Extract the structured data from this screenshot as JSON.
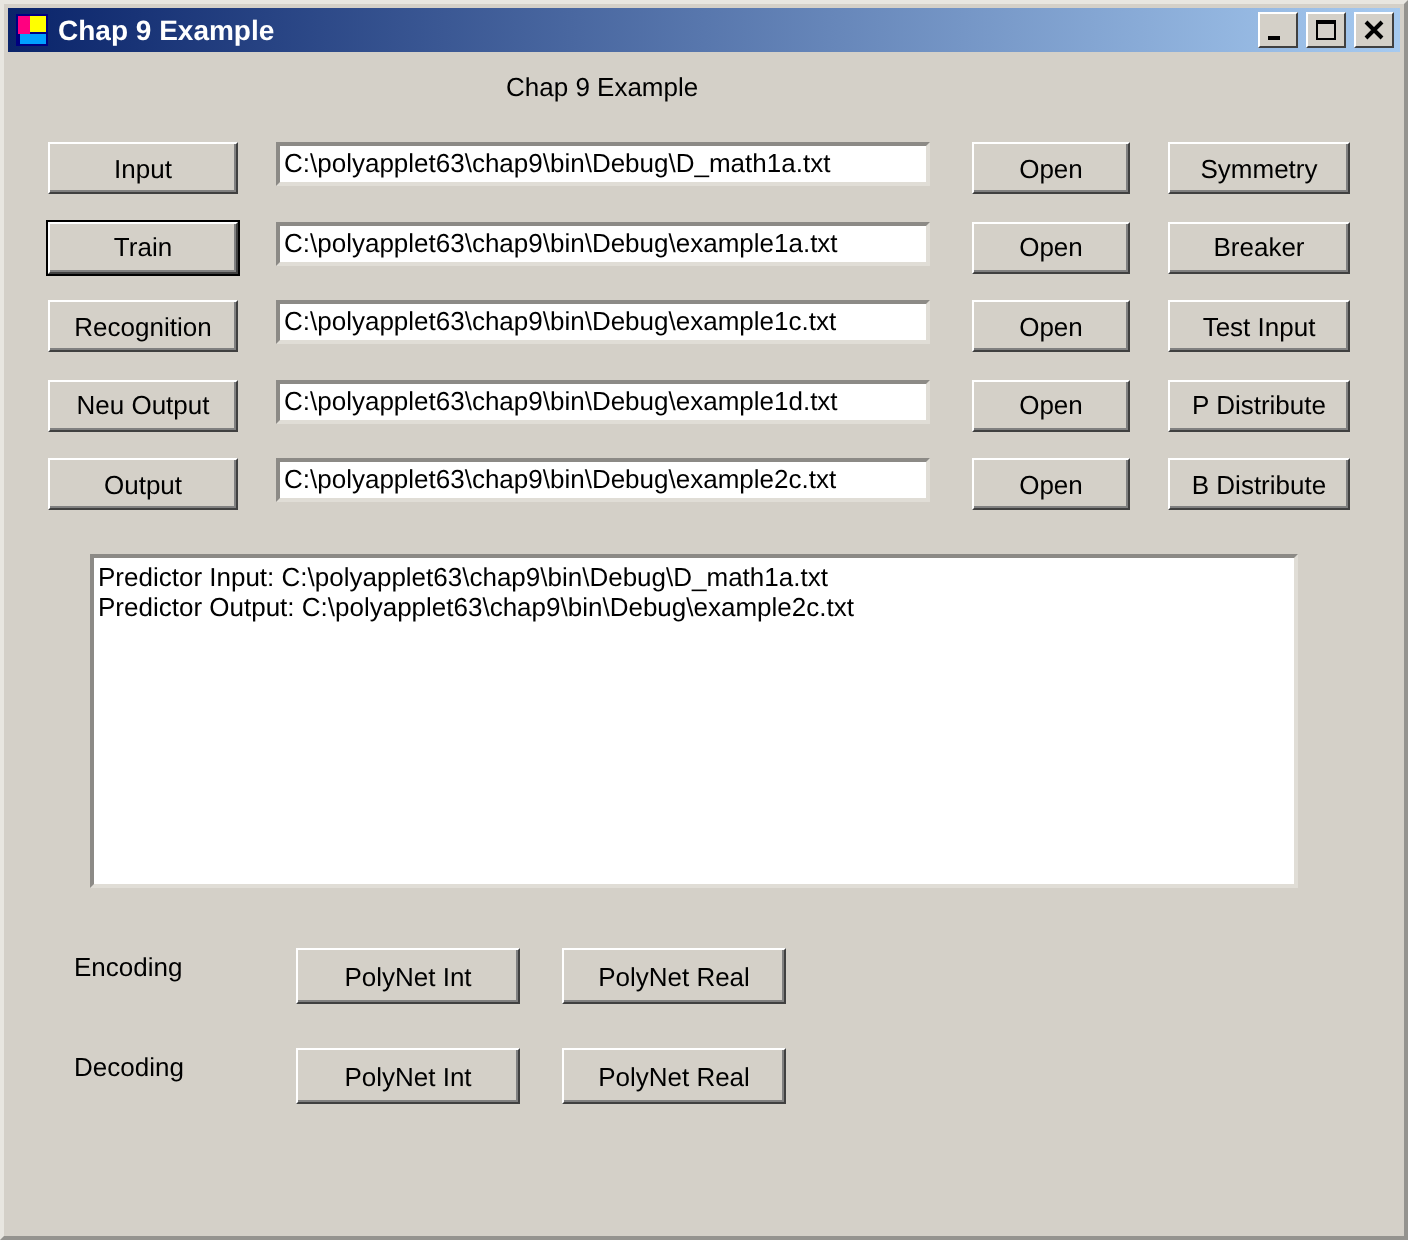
{
  "window": {
    "title": "Chap 9 Example"
  },
  "heading": "Chap 9 Example",
  "rows": [
    {
      "button": "Input",
      "focused": false,
      "path": "C:\\polyapplet63\\chap9\\bin\\Debug\\D_math1a.txt",
      "open": "Open",
      "action": "Symmetry"
    },
    {
      "button": "Train",
      "focused": true,
      "path": "C:\\polyapplet63\\chap9\\bin\\Debug\\example1a.txt",
      "open": "Open",
      "action": "Breaker"
    },
    {
      "button": "Recognition",
      "focused": false,
      "path": "C:\\polyapplet63\\chap9\\bin\\Debug\\example1c.txt",
      "open": "Open",
      "action": "Test Input"
    },
    {
      "button": "Neu Output",
      "focused": false,
      "path": "C:\\polyapplet63\\chap9\\bin\\Debug\\example1d.txt",
      "open": "Open",
      "action": "P Distribute"
    },
    {
      "button": "Output",
      "focused": false,
      "path": "C:\\polyapplet63\\chap9\\bin\\Debug\\example2c.txt",
      "open": "Open",
      "action": "B Distribute"
    }
  ],
  "log": [
    "Predictor Input: C:\\polyapplet63\\chap9\\bin\\Debug\\D_math1a.txt",
    "Predictor Output: C:\\polyapplet63\\chap9\\bin\\Debug\\example2c.txt"
  ],
  "coding": [
    {
      "label": "Encoding",
      "buttons": [
        "PolyNet Int",
        "PolyNet Real"
      ]
    },
    {
      "label": "Decoding",
      "buttons": [
        "PolyNet Int",
        "PolyNet Real"
      ]
    }
  ]
}
